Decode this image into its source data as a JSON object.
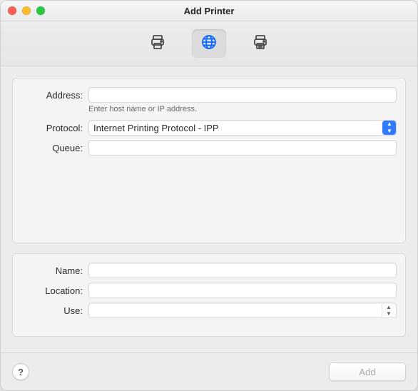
{
  "window": {
    "title": "Add Printer"
  },
  "toolbar": {
    "tabs": [
      {
        "name": "default-printer",
        "active": false
      },
      {
        "name": "ip-printer",
        "active": true
      },
      {
        "name": "windows-printer",
        "active": false
      }
    ]
  },
  "form": {
    "address": {
      "label": "Address:",
      "value": "",
      "hint": "Enter host name or IP address."
    },
    "protocol": {
      "label": "Protocol:",
      "value": "Internet Printing Protocol - IPP"
    },
    "queue": {
      "label": "Queue:",
      "value": ""
    },
    "name": {
      "label": "Name:",
      "value": ""
    },
    "location": {
      "label": "Location:",
      "value": ""
    },
    "use": {
      "label": "Use:",
      "value": ""
    }
  },
  "footer": {
    "help": "?",
    "add": "Add"
  }
}
